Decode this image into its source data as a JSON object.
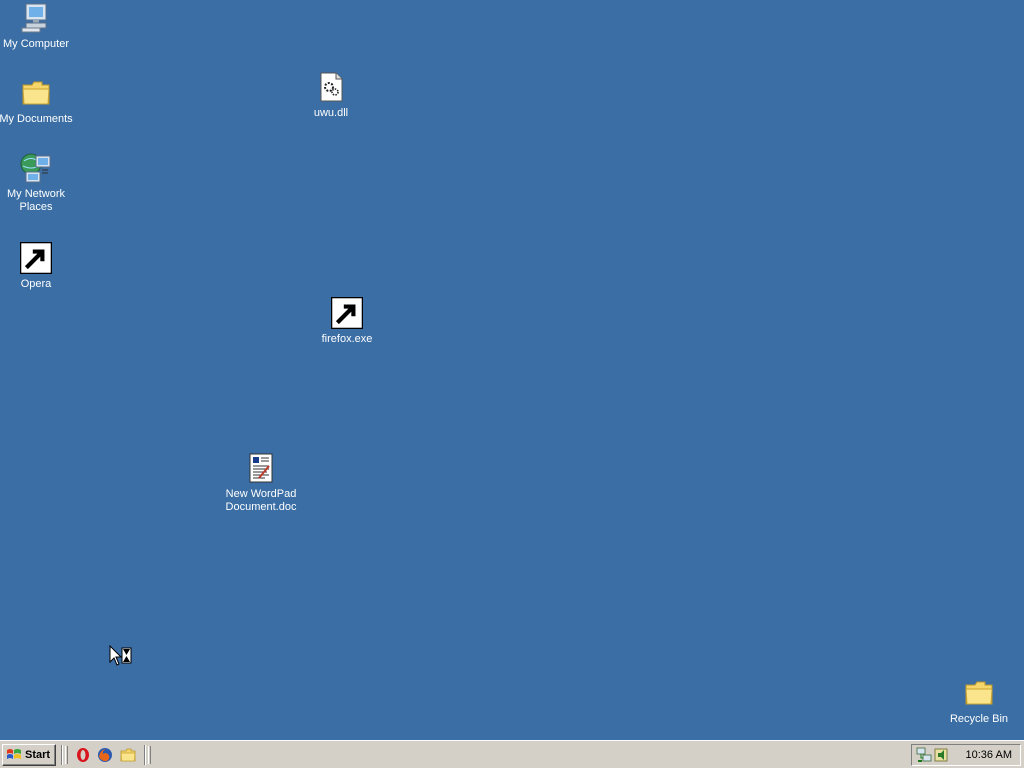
{
  "desktop": {
    "background": "#3a6ea5",
    "icons": [
      {
        "label": "My Computer",
        "icon": "my-computer-icon"
      },
      {
        "label": "My Documents",
        "icon": "folder-icon"
      },
      {
        "label": "My Network Places",
        "icon": "network-places-icon"
      },
      {
        "label": "Opera",
        "icon": "opera-icon"
      },
      {
        "label": "uwu.dll",
        "icon": "dll-file-icon"
      },
      {
        "label": "firefox.exe",
        "icon": "firefox-icon"
      },
      {
        "label": "New WordPad Document.doc",
        "icon": "wordpad-document-icon"
      },
      {
        "label": "Recycle Bin",
        "icon": "folder-icon"
      }
    ]
  },
  "taskbar": {
    "start_label": "Start",
    "quick_launch": [
      "opera-icon",
      "firefox-icon",
      "folder-icon"
    ],
    "tray_icons": [
      "network-icon",
      "volume-icon"
    ],
    "clock": "10:36 AM"
  }
}
